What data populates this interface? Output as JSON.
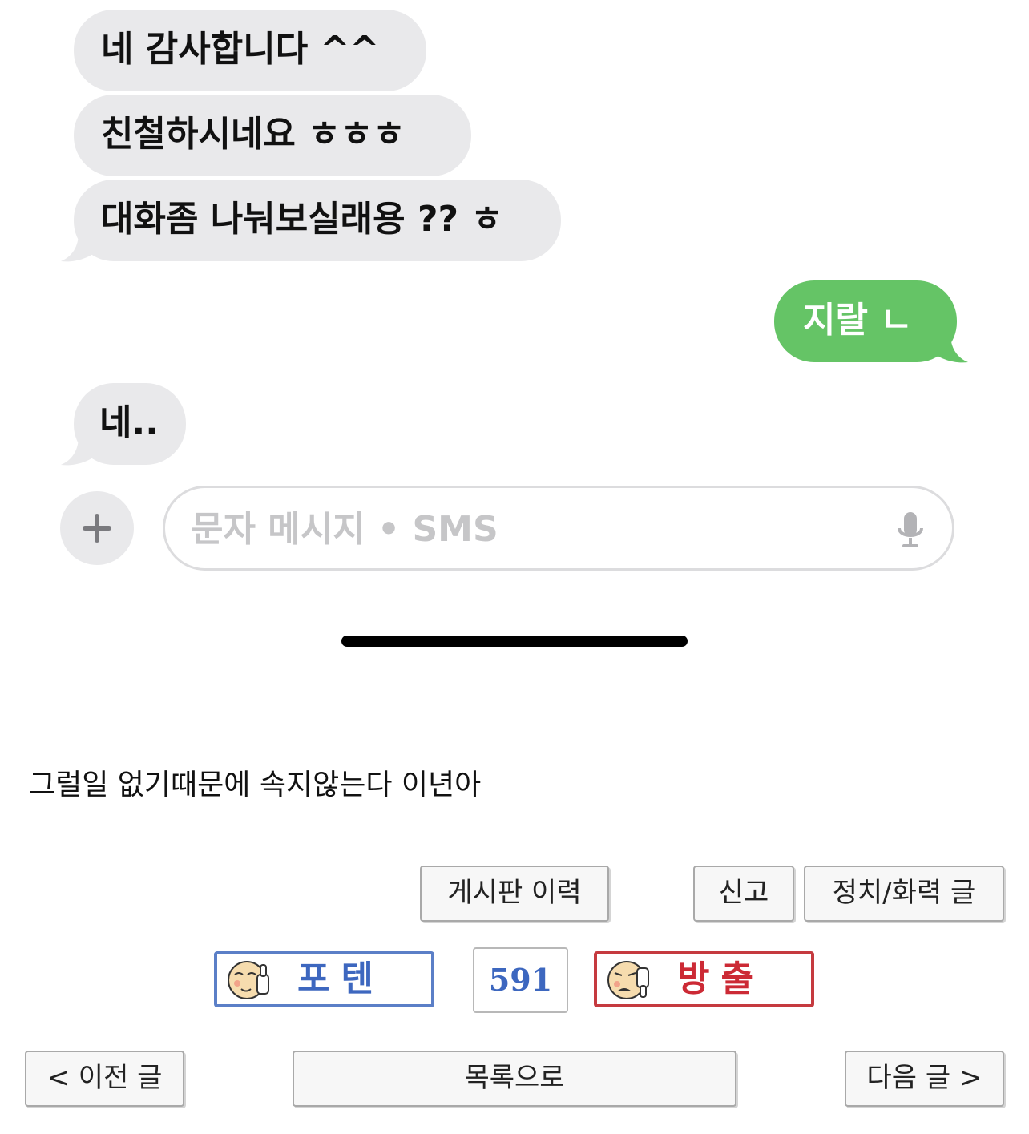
{
  "conversation": {
    "messages": [
      {
        "direction": "incoming",
        "text": "네 감사합니다 ^^"
      },
      {
        "direction": "incoming",
        "text": "친철하시네요 ㅎㅎㅎ"
      },
      {
        "direction": "incoming",
        "text": "대화좀 나눠보실래용 ?? ㅎ"
      },
      {
        "direction": "outgoing",
        "text": "지랄 ㄴ"
      },
      {
        "direction": "incoming",
        "text": "네.."
      }
    ],
    "colors": {
      "incoming_bubble": "#e9e9eb",
      "outgoing_bubble": "#65c466"
    }
  },
  "composer": {
    "placeholder": "문자 메시지 • SMS",
    "add_icon": "plus-icon",
    "mic_icon": "microphone-icon"
  },
  "post": {
    "caption": "그럴일 없기때문에 속지않는다 이년아"
  },
  "post_actions": {
    "history_label": "게시판 이력",
    "report_label": "신고",
    "category_label": "정치/화력 글"
  },
  "voting": {
    "upvote_label": "포텐",
    "upvote_icon": "thumbs-up-face-icon",
    "count": "591",
    "downvote_label": "방출",
    "downvote_icon": "thumbs-down-face-icon",
    "colors": {
      "upvote": "#3d67bf",
      "downvote": "#cc2a35"
    }
  },
  "navigation": {
    "prev_label": "< 이전 글",
    "list_label": "목록으로",
    "next_label": "다음 글 >"
  }
}
